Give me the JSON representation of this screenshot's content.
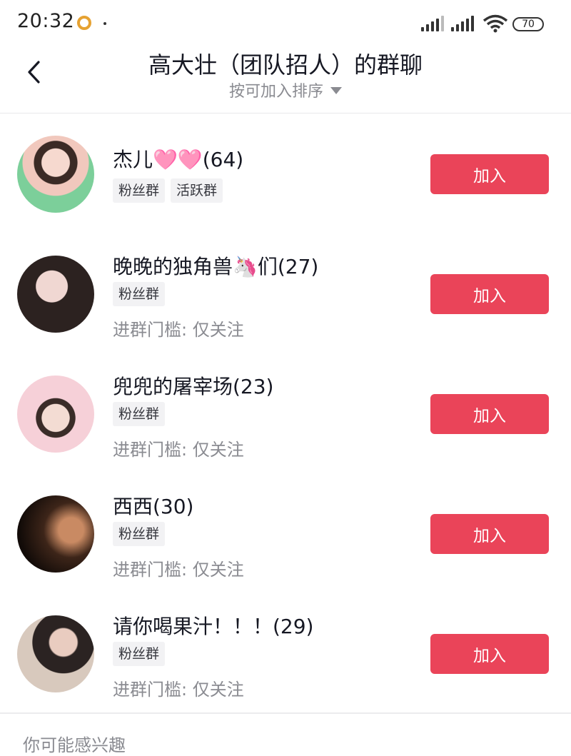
{
  "status_bar": {
    "time": "20:32",
    "battery": "70"
  },
  "header": {
    "title": "高大壮（团队招人）的群聊",
    "sort_label": "按可加入排序"
  },
  "groups": [
    {
      "name": "杰儿🩷🩷(64)",
      "tags": [
        "粉丝群",
        "活跃群"
      ],
      "threshold": "",
      "join_label": "加入"
    },
    {
      "name": "晚晚的独角兽🦄们(27)",
      "tags": [
        "粉丝群"
      ],
      "threshold": "进群门槛: 仅关注",
      "join_label": "加入"
    },
    {
      "name": "兜兜的屠宰场(23)",
      "tags": [
        "粉丝群"
      ],
      "threshold": "进群门槛: 仅关注",
      "join_label": "加入"
    },
    {
      "name": " 西西(30)",
      "tags": [
        "粉丝群"
      ],
      "threshold": "进群门槛: 仅关注",
      "join_label": "加入"
    },
    {
      "name": "请你喝果汁！！！(29)",
      "tags": [
        "粉丝群"
      ],
      "threshold": "进群门槛: 仅关注",
      "join_label": "加入"
    }
  ],
  "suggestions": {
    "title": "你可能感兴趣"
  }
}
